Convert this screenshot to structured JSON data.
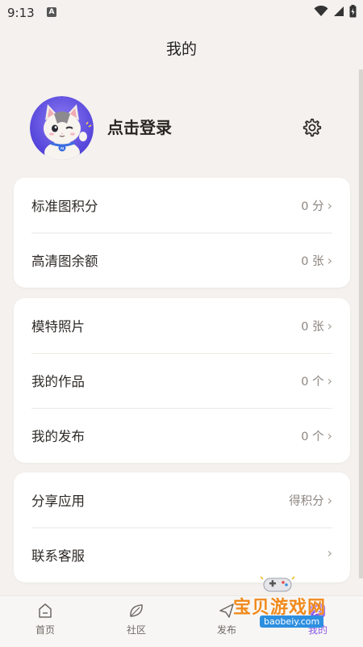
{
  "status_bar": {
    "time": "9:13",
    "notification": "A"
  },
  "header": {
    "title": "我的"
  },
  "profile": {
    "login_text": "点击登录"
  },
  "cards": [
    {
      "rows": [
        {
          "label": "标准图积分",
          "value": "0 分"
        },
        {
          "label": "高清图余额",
          "value": "0 张"
        }
      ]
    },
    {
      "rows": [
        {
          "label": "模特照片",
          "value": "0 张"
        },
        {
          "label": "我的作品",
          "value": "0 个"
        },
        {
          "label": "我的发布",
          "value": "0 个"
        }
      ]
    },
    {
      "rows": [
        {
          "label": "分享应用",
          "value": "得积分"
        },
        {
          "label": "联系客服",
          "value": ""
        }
      ]
    }
  ],
  "chevron": "›",
  "bottom_nav": {
    "items": [
      {
        "label": "首页",
        "icon": "home-icon"
      },
      {
        "label": "社区",
        "icon": "leaf-icon"
      },
      {
        "label": "发布",
        "icon": "publish-icon"
      },
      {
        "label": "我的",
        "icon": "profile-icon",
        "active": true
      }
    ]
  },
  "watermark": {
    "text": "宝贝游戏网",
    "url": "baobeiy.com"
  },
  "colors": {
    "accent": "#8a57e6",
    "background": "#f4f1ee",
    "card": "#ffffff",
    "watermark": "#f08a1c"
  }
}
